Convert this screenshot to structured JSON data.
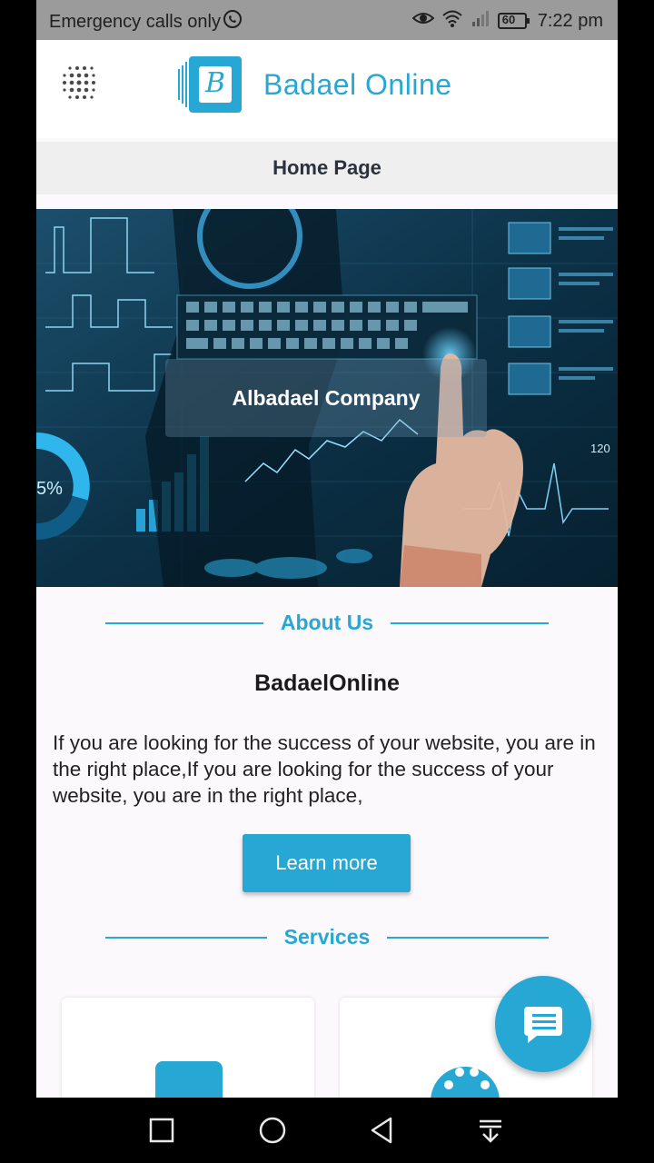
{
  "status_bar": {
    "carrier_text": "Emergency calls only",
    "battery": "60",
    "time": "7:22 pm",
    "icons": [
      "whatsapp-icon",
      "eye-icon",
      "wifi-icon",
      "signal-icon",
      "battery-icon"
    ]
  },
  "app_bar": {
    "title": "Badael Online",
    "logo_letter": "B",
    "menu_icon": "dots-grid-icon"
  },
  "page_header": {
    "title": "Home Page"
  },
  "hero": {
    "label": "Albadael Company",
    "image_texts": {
      "percent": "5%",
      "reading": "120"
    }
  },
  "about": {
    "heading": "About Us",
    "brand": "BadaelOnline",
    "paragraph": "If you are looking for the success of your website, you are in the right place,If you are looking for the success of your website, you are in the right place,",
    "button_label": "Learn more"
  },
  "services": {
    "heading": "Services"
  },
  "fab": {
    "icon": "chat-icon"
  },
  "nav_bar": {
    "buttons": [
      "square-icon",
      "circle-icon",
      "triangle-back-icon",
      "download-icon"
    ]
  },
  "colors": {
    "accent": "#27a8d4",
    "page_bg": "#fcf9fc",
    "status_bar": "#9b9b9b"
  }
}
